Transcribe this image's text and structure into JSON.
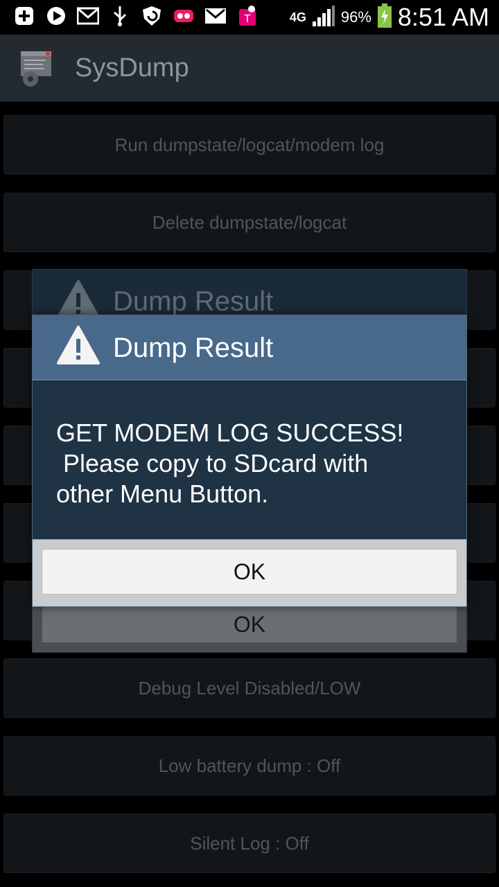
{
  "status_bar": {
    "icons": [
      "add-icon",
      "play-icon",
      "mail-icon",
      "usb-icon",
      "shield-icon",
      "voicemail-icon",
      "gmail-icon",
      "tmobile-icon"
    ],
    "network": "4G",
    "battery_percent": "96%",
    "time": "8:51 AM"
  },
  "action_bar": {
    "title": "SysDump",
    "icon": "sysdump-app-icon"
  },
  "menu": {
    "items": [
      "Run dumpstate/logcat/modem log",
      "Delete dumpstate/logcat",
      "Debug Level Disabled/LOW",
      "Low battery dump : Off",
      "Silent Log : Off"
    ]
  },
  "ghost_dialog": {
    "title": "Dump Result",
    "ok_label": "OK"
  },
  "dialog": {
    "title": "Dump Result",
    "icon": "warning-icon",
    "message": "GET MODEM LOG SUCCESS!\n Please copy to SDcard with\nother Menu Button.",
    "ok_label": "OK"
  },
  "colors": {
    "dialog_header": "#48698a",
    "dialog_body": "#1f3345",
    "action_bar": "#232a30",
    "battery": "#8bc34a"
  }
}
